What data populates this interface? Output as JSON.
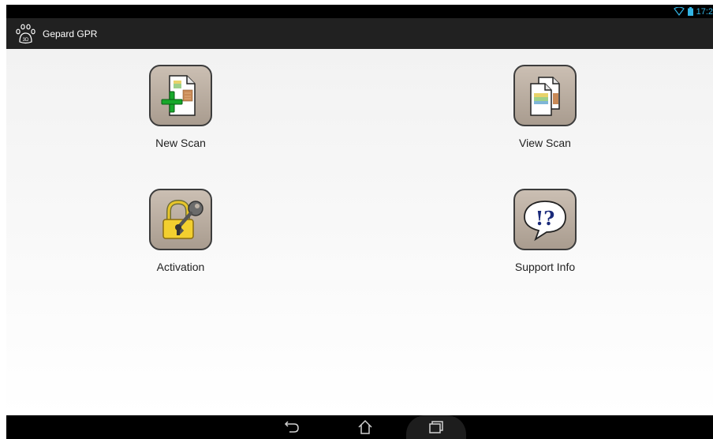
{
  "status_bar": {
    "time": "17:2",
    "icons": [
      "wifi-icon",
      "battery-icon"
    ],
    "accent_color": "#33b5e5"
  },
  "action_bar": {
    "title": "Gepard GPR",
    "app_icon": "paw-3d-icon",
    "app_icon_text": "3D"
  },
  "tiles": [
    {
      "label": "New Scan",
      "icon": "new-scan-icon"
    },
    {
      "label": "View Scan",
      "icon": "view-scan-icon"
    },
    {
      "label": "Activation",
      "icon": "padlock-key-icon"
    },
    {
      "label": "Support Info",
      "icon": "support-info-icon",
      "icon_text": "!?"
    }
  ],
  "nav_bar": {
    "buttons": [
      "back-icon",
      "home-icon",
      "recent-apps-icon"
    ]
  }
}
